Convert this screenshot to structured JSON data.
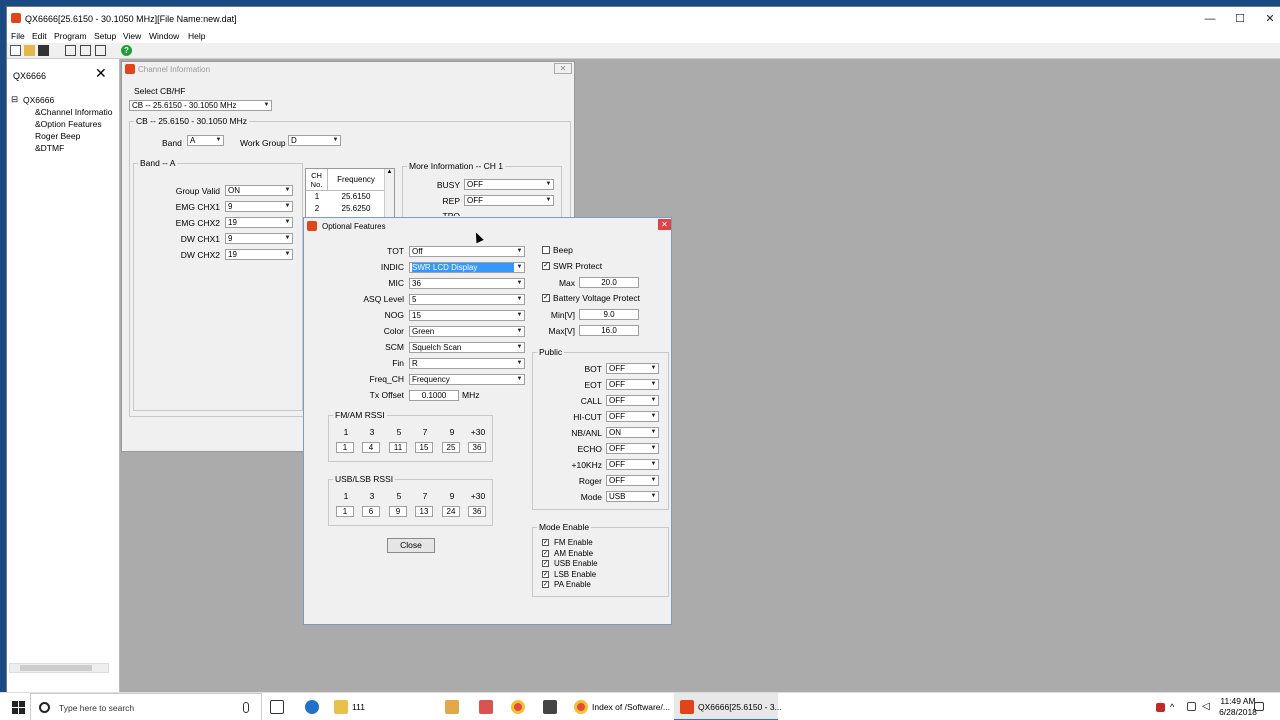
{
  "app": {
    "title": "QX6666[25.6150 - 30.1050 MHz][File Name:new.dat]",
    "menu": [
      "File",
      "Edit",
      "Program",
      "Setup",
      "View",
      "Window",
      "Help"
    ],
    "window_buttons": [
      "—",
      "☐",
      "✕"
    ]
  },
  "tree": {
    "header": "QX6666",
    "close": "✕",
    "root": "QX6666",
    "root_toggle": "⊟",
    "items": [
      "&Channel Informatio",
      "&Option Features",
      "Roger Beep",
      "&DTMF"
    ]
  },
  "channel_info": {
    "title": "Channel Information",
    "close": "✕",
    "select_label": "Select CB/HF",
    "select_value": "CB -- 25.6150 - 30.1050 MHz",
    "group_title": "CB -- 25.6150 - 30.1050 MHz",
    "band_label": "Band",
    "band_value": "A",
    "work_group_label": "Work Group",
    "work_group_value": "D",
    "band_group_title": "Band -- A",
    "rows": [
      {
        "label": "Group Valid",
        "value": "ON"
      },
      {
        "label": "EMG CHX1",
        "value": "9"
      },
      {
        "label": "EMG CHX2",
        "value": "19"
      },
      {
        "label": "DW CHX1",
        "value": "9"
      },
      {
        "label": "DW CHX2",
        "value": "19"
      }
    ],
    "table": {
      "col_ch": "CH No.",
      "col_freq": "Frequency",
      "rows": [
        {
          "ch": "1",
          "freq": "25.6150"
        },
        {
          "ch": "2",
          "freq": "25.6250"
        }
      ]
    },
    "more_title": "More Information -- CH 1",
    "more": [
      {
        "label": "BUSY",
        "value": "OFF"
      },
      {
        "label": "REP",
        "value": "OFF"
      }
    ],
    "more_partial": "TPO"
  },
  "optional": {
    "title": "Optional Features",
    "close": "✕",
    "left": [
      {
        "label": "TOT",
        "value": "Off"
      },
      {
        "label": "INDIC",
        "value": "SWR LCD Display"
      },
      {
        "label": "MIC",
        "value": "36"
      },
      {
        "label": "ASQ Level",
        "value": "5"
      },
      {
        "label": "NOG",
        "value": "15"
      },
      {
        "label": "Color",
        "value": "Green"
      },
      {
        "label": "SCM",
        "value": "Squelch Scan"
      },
      {
        "label": "Fin",
        "value": "R"
      },
      {
        "label": "Freq_CH",
        "value": "Frequency"
      }
    ],
    "tx_offset_label": "Tx Offset",
    "tx_offset_value": "0.1000",
    "tx_offset_unit": "MHz",
    "fm_rssi": {
      "title": "FM/AM RSSI",
      "headers": [
        "1",
        "3",
        "5",
        "7",
        "9",
        "+30"
      ],
      "values": [
        "1",
        "4",
        "11",
        "15",
        "25",
        "36"
      ]
    },
    "usb_rssi": {
      "title": "USB/LSB RSSI",
      "headers": [
        "1",
        "3",
        "5",
        "7",
        "9",
        "+30"
      ],
      "values": [
        "1",
        "6",
        "9",
        "13",
        "24",
        "36"
      ]
    },
    "close_label": "Close",
    "beep": {
      "label": "Beep",
      "checked": false
    },
    "swr_protect": {
      "label": "SWR Protect",
      "checked": true
    },
    "swr_max_label": "Max",
    "swr_max_value": "20.0",
    "battery": {
      "label": "Battery Voltage Protect",
      "checked": true
    },
    "min_label": "Min[V]",
    "min_value": "9.0",
    "max_label": "Max[V]",
    "max_value": "16.0",
    "public_title": "Public",
    "public": [
      {
        "label": "BOT",
        "value": "OFF"
      },
      {
        "label": "EOT",
        "value": "OFF"
      },
      {
        "label": "CALL",
        "value": "OFF"
      },
      {
        "label": "HI-CUT",
        "value": "OFF"
      },
      {
        "label": "NB/ANL",
        "value": "ON"
      },
      {
        "label": "ECHO",
        "value": "OFF"
      },
      {
        "label": "+10KHz",
        "value": "OFF"
      },
      {
        "label": "Roger",
        "value": "OFF"
      },
      {
        "label": "Mode",
        "value": "USB"
      }
    ],
    "mode_title": "Mode Enable",
    "modes": [
      {
        "label": "FM Enable",
        "checked": true
      },
      {
        "label": "AM Enable",
        "checked": true
      },
      {
        "label": "USB Enable",
        "checked": true
      },
      {
        "label": "LSB Enable",
        "checked": true
      },
      {
        "label": "PA Enable",
        "checked": true
      }
    ]
  },
  "taskbar": {
    "search_placeholder": "Type here to search",
    "explorer_label": "111",
    "chrome_label": "Index of /Software/...",
    "app_label": "QX6666[25.6150 - 3...",
    "time": "11:49 AM",
    "date": "6/28/2018"
  },
  "colors": {
    "selection": "#3399ff",
    "accent": "#2b72d0",
    "app_icon": "#e0441b"
  }
}
